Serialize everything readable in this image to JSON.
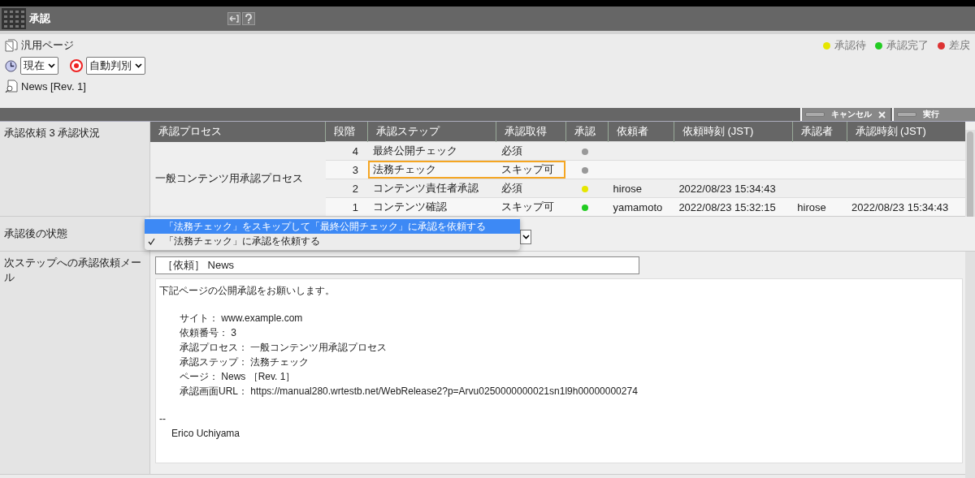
{
  "header": {
    "title": "承認"
  },
  "page_type": {
    "label": "汎用ページ"
  },
  "selectors": [
    {
      "kind": "clock",
      "value": "現在"
    },
    {
      "kind": "target",
      "value": "自動判別"
    }
  ],
  "page": {
    "label": "News [Rev. 1]"
  },
  "legend": [
    {
      "label": "承認待",
      "color": "#e6e600"
    },
    {
      "label": "承認完了",
      "color": "#22cc22"
    },
    {
      "label": "差戻",
      "color": "#dd3333"
    }
  ],
  "toolbar": {
    "buttons": [
      {
        "label": "キャンセル",
        "kind": "cancel"
      },
      {
        "label": "実行",
        "kind": "run"
      }
    ]
  },
  "status": {
    "label": "承認依頼 3 承認状況",
    "table": {
      "columns": [
        "承認プロセス",
        "段階",
        "承認ステップ",
        "承認取得",
        "承認",
        "依頼者",
        "依頼時刻 (JST)",
        "承認者",
        "承認時刻 (JST)"
      ],
      "process": "一般コンテンツ用承認プロセス",
      "rows": [
        {
          "stage": "4",
          "step": "最終公開チェック",
          "requirement": "必須",
          "color": "#999999",
          "requester": "",
          "requested_at": "",
          "approver": "",
          "approved_at": "",
          "focused": false
        },
        {
          "stage": "3",
          "step": "法務チェック",
          "requirement": "スキップ可",
          "color": "#999999",
          "requester": "",
          "requested_at": "",
          "approver": "",
          "approved_at": "",
          "focused": true
        },
        {
          "stage": "2",
          "step": "コンテンツ責任者承認",
          "requirement": "必須",
          "color": "#e6e600",
          "requester": "hirose",
          "requested_at": "2022/08/23 15:34:43",
          "approver": "",
          "approved_at": "",
          "focused": false
        },
        {
          "stage": "1",
          "step": "コンテンツ確認",
          "requirement": "スキップ可",
          "color": "#22cc22",
          "requester": "yamamoto",
          "requested_at": "2022/08/23 15:32:15",
          "approver": "hirose",
          "approved_at": "2022/08/23 15:34:43",
          "focused": false
        }
      ]
    }
  },
  "after_state": {
    "label": "承認後の状態",
    "options": [
      {
        "label": "「法務チェック」をスキップして「最終公開チェック」に承認を依頼する",
        "highlighted": true,
        "checked": false
      },
      {
        "label": "「法務チェック」に承認を依頼する",
        "highlighted": false,
        "checked": true
      }
    ]
  },
  "mail": {
    "label": "次ステップへの承認依頼メール",
    "subject": "［依頼］ News",
    "blocks": [
      {
        "lines": [
          {
            "text": "下記ページの公開承認をお願いします。",
            "indented": false
          }
        ]
      },
      {
        "lines": [
          {
            "text": "サイト： www.example.com",
            "indented": true
          },
          {
            "text": "依頼番号： 3",
            "indented": true
          },
          {
            "text": "承認プロセス： 一般コンテンツ用承認プロセス",
            "indented": true
          },
          {
            "text": "承認ステップ： 法務チェック",
            "indented": true
          },
          {
            "text": "ページ： News ［Rev. 1］",
            "indented": true
          },
          {
            "text": "承認画面URL： https://manual280.wrtestb.net/WebRelease2?p=Arvu0250000000021sn1l9h00000000274",
            "indented": true
          }
        ]
      },
      {
        "lines": [
          {
            "text": "--",
            "indented": false
          },
          {
            "text": "Erico Uchiyama",
            "indented": true
          }
        ]
      }
    ]
  }
}
